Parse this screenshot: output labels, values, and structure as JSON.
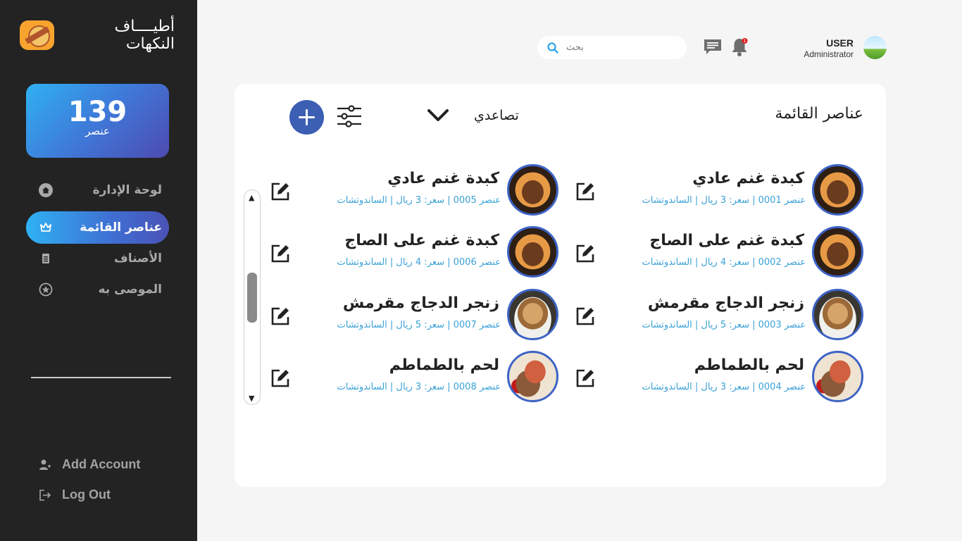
{
  "app": {
    "logo_text": "أطيــــاف النكهات"
  },
  "counter": {
    "value": "139",
    "unit": "عنصر"
  },
  "nav": {
    "items": [
      {
        "label": "لوحة الإدارة",
        "icon": "home-icon"
      },
      {
        "label": "عناصر القائمة",
        "icon": "crown-icon",
        "active": true
      },
      {
        "label": "الأصناف",
        "icon": "document-icon"
      },
      {
        "label": "الموصى به",
        "icon": "star-icon"
      }
    ]
  },
  "bottom_links": {
    "add_account": "Add Account",
    "log_out": "Log Out"
  },
  "header": {
    "search_placeholder": "بحث",
    "notification_count": "1",
    "user_name": "USER",
    "user_role": "Administrator"
  },
  "panel": {
    "title": "عناصر القائمة",
    "sort_label": "تصاعدي"
  },
  "items": [
    {
      "name": "كبدة غنم عادي",
      "meta": "عنصر 0001   |   سعر: 3 ريال   |   الساندوتشات",
      "image": "hotdog"
    },
    {
      "name": "كبدة غنم عادي",
      "meta": "عنصر 0005   |   سعر: 3 ريال   |   الساندوتشات",
      "image": "hotdog"
    },
    {
      "name": "كبدة غنم على الصاج",
      "meta": "عنصر 0002   |   سعر: 4 ريال   |   الساندوتشات",
      "image": "hotdog"
    },
    {
      "name": "كبدة غنم على الصاج",
      "meta": "عنصر 0006   |   سعر: 4 ريال   |   الساندوتشات",
      "image": "hotdog"
    },
    {
      "name": "زنجر الدجاج مقرمش",
      "meta": "عنصر 0003   |   سعر: 5 ريال   |   الساندوتشات",
      "image": "chicken"
    },
    {
      "name": "زنجر الدجاج مقرمش",
      "meta": "عنصر 0007   |   سعر: 5 ريال   |   الساندوتشات",
      "image": "chicken"
    },
    {
      "name": "لحم بالطماطم",
      "meta": "عنصر 0004   |   سعر: 3 ريال   |   الساندوتشات",
      "image": "meat"
    },
    {
      "name": "لحم بالطماطم",
      "meta": "عنصر 0008   |   سعر: 3 ريال   |   الساندوتشات",
      "image": "meat"
    }
  ],
  "colors": {
    "sidebar_bg": "#232323",
    "accent_blue": "#3c5fb4",
    "meta_text": "#3aa1d7"
  }
}
